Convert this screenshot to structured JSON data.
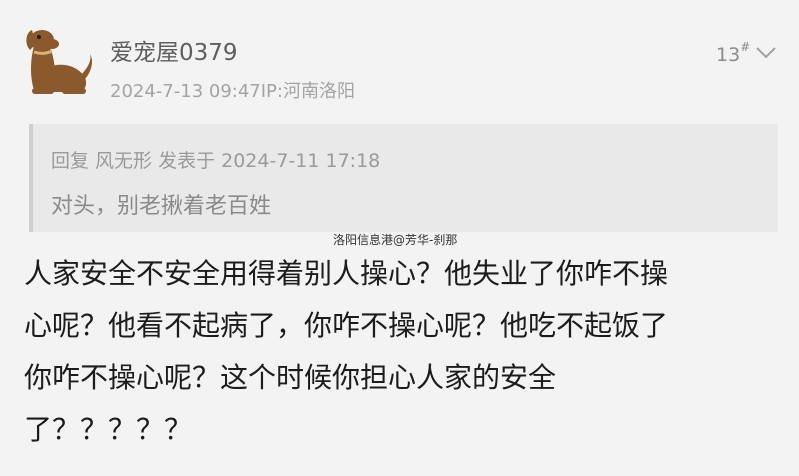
{
  "post": {
    "username": "爱宠屋0379",
    "meta": "2024-7-13 09:47IP:河南洛阳",
    "floor_number": "13",
    "floor_mark": "#",
    "avatar_icon": "dog-logo-icon",
    "menu_icon": "chevron-down-icon",
    "quote": {
      "header": "回复 风无形 发表于 2024-7-11 17:18",
      "text": "对头，别老揪着老百姓"
    },
    "watermark": "洛阳信息港@芳华-刹那",
    "body_lines": [
      "人家安全不安全用得着别人操心？他失业了你咋不操",
      "心呢？他看不起病了，你咋不操心呢？他吃不起饭了",
      "你咋不操心呢？这个时候你担心人家的安全",
      "了？？？？？"
    ]
  },
  "colors": {
    "background": "#f3f3f3",
    "quote_background": "#e9e9e9",
    "avatar_brown": "#8a5a2c"
  }
}
